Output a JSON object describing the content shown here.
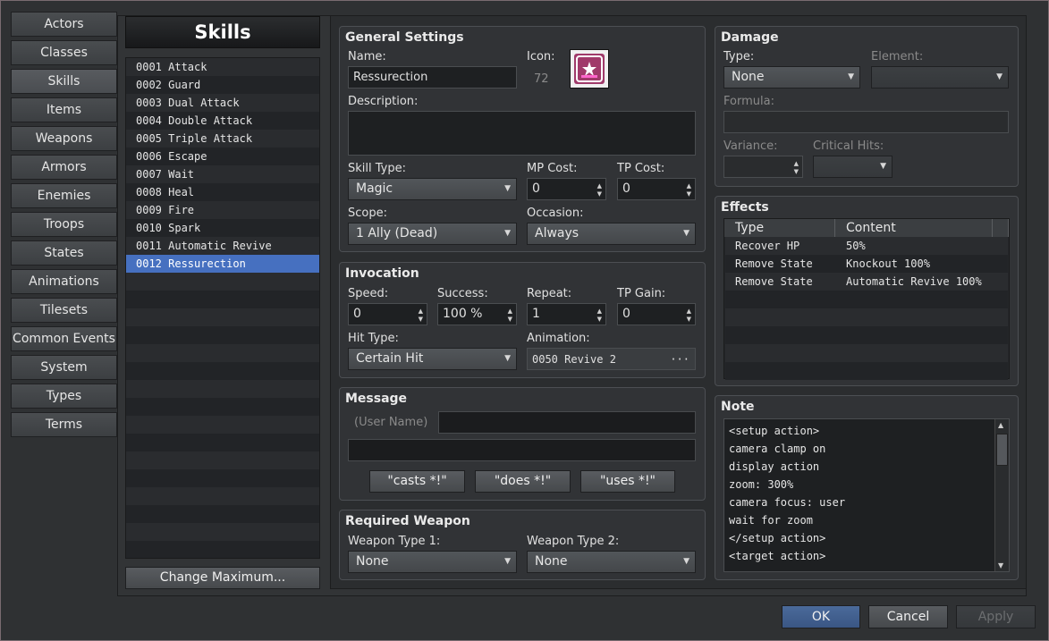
{
  "nav": [
    "Actors",
    "Classes",
    "Skills",
    "Items",
    "Weapons",
    "Armors",
    "Enemies",
    "Troops",
    "States",
    "Animations",
    "Tilesets",
    "Common Events",
    "System",
    "Types",
    "Terms"
  ],
  "list": {
    "title": "Skills",
    "items": [
      "0001 Attack",
      "0002 Guard",
      "0003 Dual Attack",
      "0004 Double Attack",
      "0005 Triple Attack",
      "0006 Escape",
      "0007 Wait",
      "0008 Heal",
      "0009 Fire",
      "0010 Spark",
      "0011 Automatic Revive",
      "0012 Ressurection"
    ],
    "selected_index": 11,
    "change_max_label": "Change Maximum..."
  },
  "general": {
    "title": "General Settings",
    "name_label": "Name:",
    "name_value": "Ressurection",
    "icon_label": "Icon:",
    "icon_index": "72",
    "description_label": "Description:",
    "description_value": "",
    "skill_type_label": "Skill Type:",
    "skill_type_value": "Magic",
    "mp_cost_label": "MP Cost:",
    "mp_cost_value": "0",
    "tp_cost_label": "TP Cost:",
    "tp_cost_value": "0",
    "scope_label": "Scope:",
    "scope_value": "1 Ally (Dead)",
    "occasion_label": "Occasion:",
    "occasion_value": "Always"
  },
  "invocation": {
    "title": "Invocation",
    "speed_label": "Speed:",
    "speed_value": "0",
    "success_label": "Success:",
    "success_value": "100 %",
    "repeat_label": "Repeat:",
    "repeat_value": "1",
    "tp_gain_label": "TP Gain:",
    "tp_gain_value": "0",
    "hit_type_label": "Hit Type:",
    "hit_type_value": "Certain Hit",
    "animation_label": "Animation:",
    "animation_value": "0050 Revive 2",
    "animation_btn": "···"
  },
  "message": {
    "title": "Message",
    "user_name_label": "(User Name)",
    "line1": "",
    "line2": "",
    "casts_btn": "\"casts *!\"",
    "does_btn": "\"does *!\"",
    "uses_btn": "\"uses *!\""
  },
  "weapon": {
    "title": "Required Weapon",
    "type1_label": "Weapon Type 1:",
    "type1_value": "None",
    "type2_label": "Weapon Type 2:",
    "type2_value": "None"
  },
  "damage": {
    "title": "Damage",
    "type_label": "Type:",
    "type_value": "None",
    "element_label": "Element:",
    "element_value": "",
    "formula_label": "Formula:",
    "formula_value": "",
    "variance_label": "Variance:",
    "critical_label": "Critical Hits:"
  },
  "effects": {
    "title": "Effects",
    "col_type": "Type",
    "col_content": "Content",
    "rows": [
      {
        "type": "Recover HP",
        "content": "50%"
      },
      {
        "type": "Remove State",
        "content": "Knockout 100%"
      },
      {
        "type": "Remove State",
        "content": "Automatic Revive 100%"
      }
    ]
  },
  "note": {
    "title": "Note",
    "lines": [
      "<setup action>",
      "camera clamp on",
      "display action",
      "zoom: 300%",
      "camera focus: user",
      "wait for zoom",
      "</setup action>",
      "<target action>"
    ]
  },
  "footer": {
    "ok": "OK",
    "cancel": "Cancel",
    "apply": "Apply"
  },
  "colors": {
    "selected_row": "#4670c0",
    "ok_button": "#3f5f8f",
    "icon_bg": "#a03a6a"
  }
}
